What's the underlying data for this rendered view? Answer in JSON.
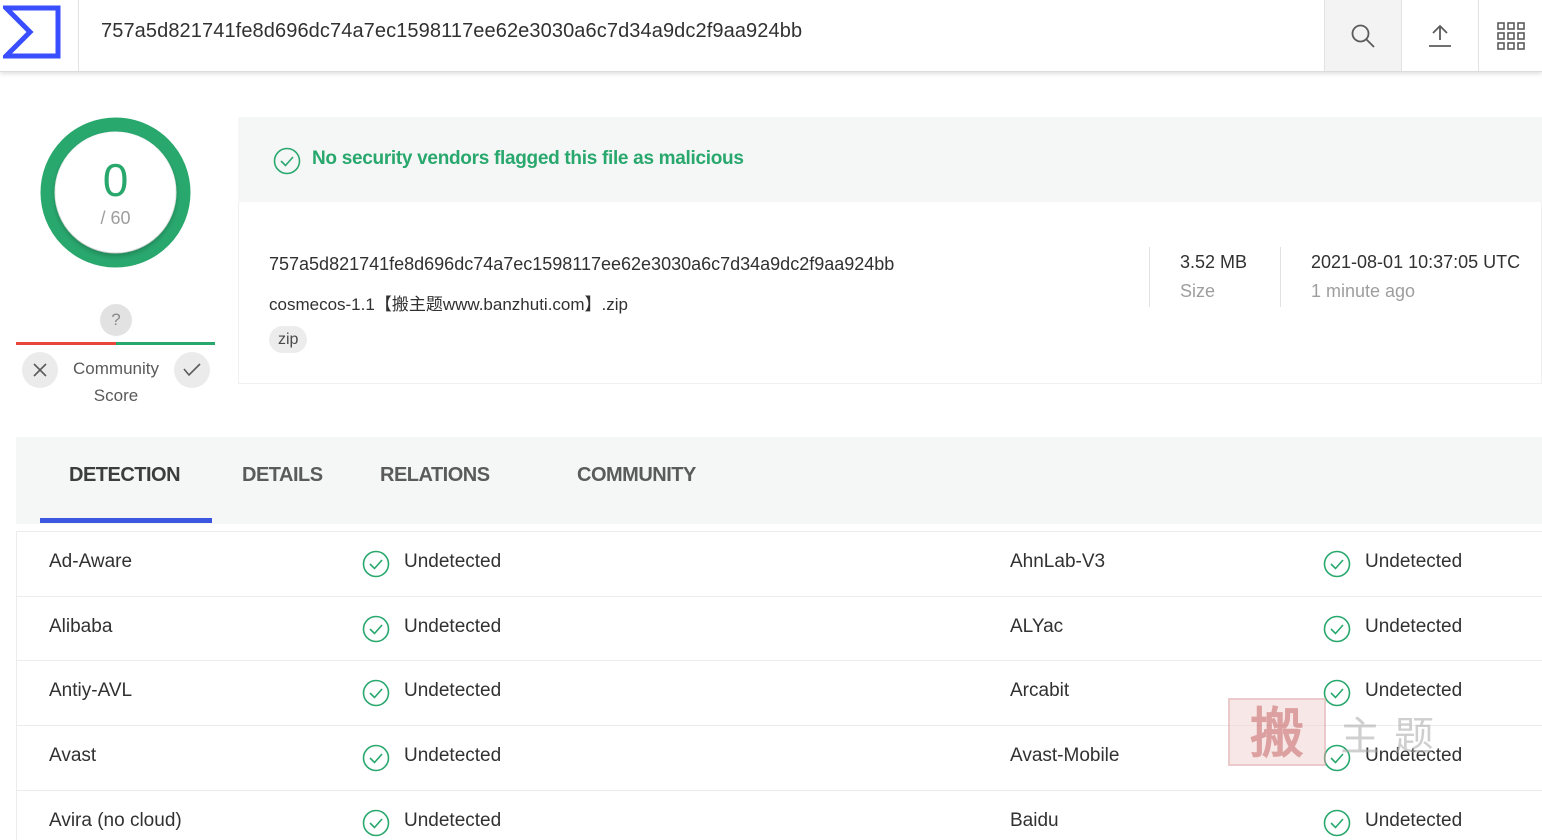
{
  "header": {
    "search_value": "757a5d821741fe8d696dc74a7ec1598117ee62e3030a6c7d34a9dc2f9aa924bb",
    "logo_icon": "virustotal-logo",
    "search_icon": "search-icon",
    "upload_icon": "upload-icon",
    "apps_icon": "apps-grid-icon"
  },
  "score": {
    "detections": "0",
    "total": "/ 60",
    "ring_color": "#29a86e",
    "question_mark": "?",
    "community_label_1": "Community",
    "community_label_2": "Score"
  },
  "banner": {
    "message": "No security vendors flagged this file as malicious",
    "color": "#29a86e"
  },
  "file": {
    "hash": "757a5d821741fe8d696dc74a7ec1598117ee62e3030a6c7d34a9dc2f9aa924bb",
    "name": "cosmecos-1.1【搬主题www.banzhuti.com】.zip",
    "tag": "zip",
    "size_value": "3.52 MB",
    "size_label": "Size",
    "date_value": "2021-08-01 10:37:05 UTC",
    "date_label": "1 minute ago"
  },
  "tabs": [
    {
      "label": "DETECTION",
      "active": true
    },
    {
      "label": "DETAILS",
      "active": false
    },
    {
      "label": "RELATIONS",
      "active": false
    },
    {
      "label": "COMMUNITY",
      "active": false
    }
  ],
  "detections": [
    {
      "left_engine": "Ad-Aware",
      "left_result": "Undetected",
      "right_engine": "AhnLab-V3",
      "right_result": "Undetected"
    },
    {
      "left_engine": "Alibaba",
      "left_result": "Undetected",
      "right_engine": "ALYac",
      "right_result": "Undetected"
    },
    {
      "left_engine": "Antiy-AVL",
      "left_result": "Undetected",
      "right_engine": "Arcabit",
      "right_result": "Undetected"
    },
    {
      "left_engine": "Avast",
      "left_result": "Undetected",
      "right_engine": "Avast-Mobile",
      "right_result": "Undetected"
    },
    {
      "left_engine": "Avira (no cloud)",
      "left_result": "Undetected",
      "right_engine": "Baidu",
      "right_result": "Undetected"
    }
  ],
  "watermark": {
    "seal_text": "搬",
    "text": "主题"
  }
}
